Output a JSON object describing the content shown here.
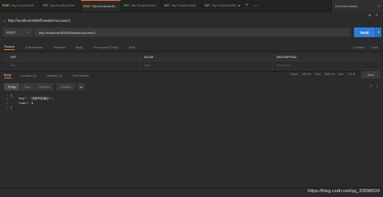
{
  "tabs": [
    {
      "method": "POST",
      "url": "http://localhost:8080/flowab...",
      "active": false,
      "dirty": false
    },
    {
      "method": "GET",
      "url": "http://localhost:8080/flowabler/...",
      "active": false,
      "dirty": false
    },
    {
      "method": "POST",
      "url": "http://localhost:8080/flowabler...",
      "active": true,
      "dirty": false
    },
    {
      "method": "GET",
      "url": "http://localhost:8080/flowable/...",
      "active": false,
      "dirty": false
    },
    {
      "method": "GET",
      "url": "http://localhost:8080/flowable/...",
      "active": false,
      "dirty": false
    },
    {
      "method": "GET",
      "url": "http://localhost:8080/flowable/...",
      "active": false,
      "dirty": true
    }
  ],
  "environment": {
    "label": "No Environment"
  },
  "request": {
    "name": "http://localhost:8080/flowable/success/1",
    "method": "POST",
    "url": "http://localhost:8080/flowable/success/1",
    "params_label": "Params",
    "send_label": "Send"
  },
  "request_tabs": [
    "Params",
    "Authorization",
    "Headers",
    "Body",
    "Pre-request Script",
    "Tests"
  ],
  "request_tabs_right": [
    "Cookies",
    "Code"
  ],
  "params_table": {
    "headers": {
      "key": "KEY",
      "value": "VALUE",
      "description": "DESCRIPTION"
    },
    "placeholder": {
      "key": "Key",
      "value": "Value",
      "description": "Description"
    }
  },
  "response": {
    "tabs": [
      "Body",
      "Cookies (1)",
      "Headers (3)",
      "Test Results"
    ],
    "status_label": "Status:",
    "status_value": "200 OK",
    "time_label": "Time:",
    "time_value": "3906 ms",
    "size_label": "Size:",
    "size_value": "176 B",
    "save_label": "Save",
    "views": [
      "Pretty",
      "Raw",
      "Preview"
    ],
    "format": "JSON",
    "code_lines": [
      "{",
      "    \"msg\": \"流程审批通过!\",",
      "    \"code\": 0",
      "}"
    ]
  },
  "watermark": "https://blog.csdn.net/qq_33598534"
}
